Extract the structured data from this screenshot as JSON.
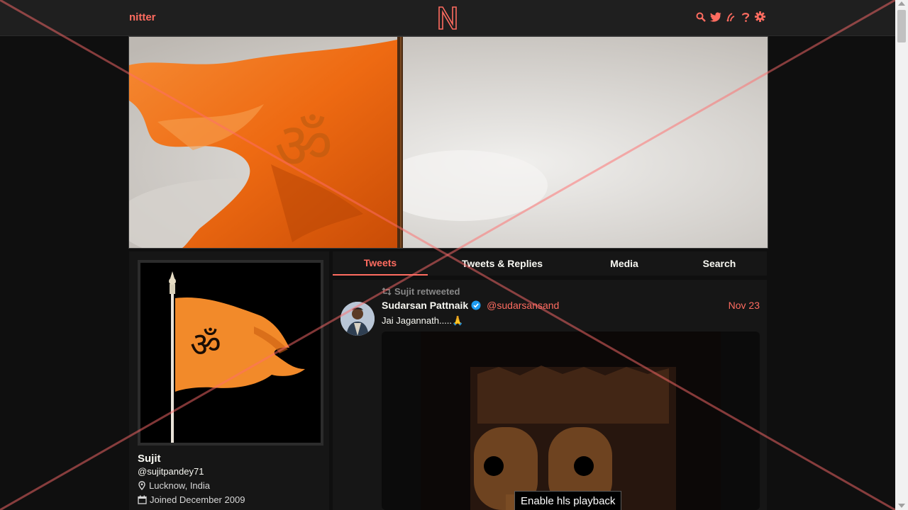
{
  "nav": {
    "brand": "nitter",
    "icons": [
      "search-icon",
      "twitter-icon",
      "rss-icon",
      "help-icon",
      "settings-icon"
    ]
  },
  "profile": {
    "name": "Sujit",
    "handle": "@sujitpandey71",
    "location": "Lucknow, India",
    "joined": "Joined December 2009"
  },
  "tabs": [
    {
      "label": "Tweets",
      "active": true
    },
    {
      "label": "Tweets & Replies",
      "active": false
    },
    {
      "label": "Media",
      "active": false
    },
    {
      "label": "Search",
      "active": false
    }
  ],
  "timeline": {
    "tweets": [
      {
        "retweet_label": "Sujit retweeted",
        "author": "Sudarsan Pattnaik",
        "verified": true,
        "handle": "@sudarsansand",
        "date": "Nov 23",
        "text": "Jai Jagannath.....🙏",
        "media_button": "Enable hls playback"
      }
    ]
  },
  "colors": {
    "accent": "#ff6c60",
    "background": "#0f0f0f",
    "panel": "#161616",
    "topbar": "#1f1f1f",
    "saffron": "#f07020"
  }
}
